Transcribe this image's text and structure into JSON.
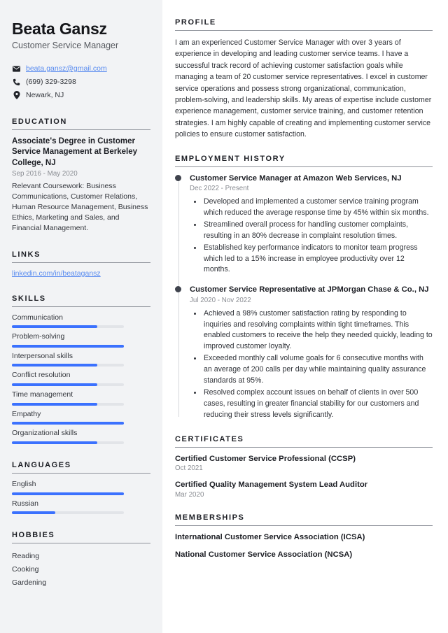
{
  "theme": {
    "accent": "#3b71fe",
    "link": "#5a8cf0",
    "sidebar_bg": "#f2f3f5",
    "main_bg": "#ffffff",
    "heading": "#1c1e24",
    "muted": "#8a8d93"
  },
  "header": {
    "name": "Beata Gansz",
    "job_title": "Customer Service Manager",
    "contacts": [
      {
        "icon": "envelope-icon",
        "text": "beata.gansz@gmail.com",
        "is_link": true
      },
      {
        "icon": "phone-icon",
        "text": "(699) 329-3298",
        "is_link": false
      },
      {
        "icon": "location-pin-icon",
        "text": "Newark, NJ",
        "is_link": false
      }
    ]
  },
  "sidebar": {
    "education": {
      "heading": "EDUCATION",
      "items": [
        {
          "title": "Associate's Degree in Customer Service Management at Berkeley College, NJ",
          "date": "Sep 2016 - May 2020",
          "description": "Relevant Coursework: Business Communications, Customer Relations, Human Resource Management, Business Ethics, Marketing and Sales, and Financial Management."
        }
      ]
    },
    "links": {
      "heading": "LINKS",
      "items": [
        {
          "label": "linkedin.com/in/beatagansz"
        }
      ]
    },
    "skills": {
      "heading": "SKILLS",
      "items": [
        {
          "label": "Communication",
          "level": 76
        },
        {
          "label": "Problem-solving",
          "level": 100
        },
        {
          "label": "Interpersonal skills",
          "level": 76
        },
        {
          "label": "Conflict resolution",
          "level": 76
        },
        {
          "label": "Time management",
          "level": 76
        },
        {
          "label": "Empathy",
          "level": 100
        },
        {
          "label": "Organizational skills",
          "level": 76
        }
      ]
    },
    "languages": {
      "heading": "LANGUAGES",
      "items": [
        {
          "label": "English",
          "level": 100
        },
        {
          "label": "Russian",
          "level": 39
        }
      ]
    },
    "hobbies": {
      "heading": "HOBBIES",
      "items": [
        {
          "label": "Reading"
        },
        {
          "label": "Cooking"
        },
        {
          "label": "Gardening"
        }
      ]
    }
  },
  "main": {
    "profile": {
      "heading": "PROFILE",
      "text": "I am an experienced Customer Service Manager with over 3 years of experience in developing and leading customer service teams. I have a successful track record of achieving customer satisfaction goals while managing a team of 20 customer service representatives. I excel in customer service operations and possess strong organizational, communication, problem-solving, and leadership skills. My areas of expertise include customer experience management, customer service training, and customer retention strategies. I am highly capable of creating and implementing customer service policies to ensure customer satisfaction."
    },
    "employment": {
      "heading": "EMPLOYMENT HISTORY",
      "jobs": [
        {
          "title": "Customer Service Manager at Amazon Web Services, NJ",
          "date": "Dec 2022 - Present",
          "bullets": [
            "Developed and implemented a customer service training program which reduced the average response time by 45% within six months.",
            "Streamlined overall process for handling customer complaints, resulting in an 80% decrease in complaint resolution times.",
            "Established key performance indicators to monitor team progress which led to a 15% increase in employee productivity over 12 months."
          ]
        },
        {
          "title": "Customer Service Representative at JPMorgan Chase & Co., NJ",
          "date": "Jul 2020 - Nov 2022",
          "bullets": [
            "Achieved a 98% customer satisfaction rating by responding to inquiries and resolving complaints within tight timeframes. This enabled customers to receive the help they needed quickly, leading to improved customer loyalty.",
            "Exceeded monthly call volume goals for 6 consecutive months with an average of 200 calls per day while maintaining quality assurance standards at 95%.",
            "Resolved complex account issues on behalf of clients in over 500 cases, resulting in greater financial stability for our customers and reducing their stress levels significantly."
          ]
        }
      ]
    },
    "certificates": {
      "heading": "CERTIFICATES",
      "items": [
        {
          "title": "Certified Customer Service Professional (CCSP)",
          "date": "Oct 2021"
        },
        {
          "title": "Certified Quality Management System Lead Auditor",
          "date": "Mar 2020"
        }
      ]
    },
    "memberships": {
      "heading": "MEMBERSHIPS",
      "items": [
        {
          "title": "International Customer Service Association (ICSA)"
        },
        {
          "title": "National Customer Service Association (NCSA)"
        }
      ]
    }
  }
}
